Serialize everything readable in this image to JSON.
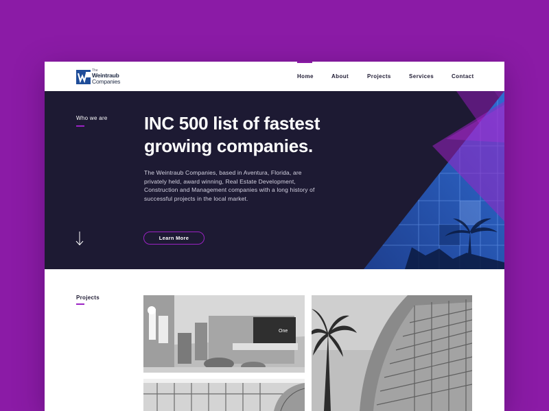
{
  "brand": {
    "logo_the": "The",
    "logo_line1": "Weintraub",
    "logo_line2": "Companies",
    "accent_color": "#8b1ba6",
    "dark_color": "#1d1a33",
    "blue_color": "#1f4d99"
  },
  "nav": {
    "items": [
      {
        "label": "Home",
        "active": true
      },
      {
        "label": "About",
        "active": false
      },
      {
        "label": "Projects",
        "active": false
      },
      {
        "label": "Services",
        "active": false
      },
      {
        "label": "Contact",
        "active": false
      }
    ]
  },
  "hero": {
    "section_label": "Who we are",
    "title_line1": "INC 500 list of fastest",
    "title_line2": "growing companies.",
    "body": "The Weintraub Companies, based in Aventura, Florida, are privately held, award winning, Real Estate Development, Construction and Management companies with a long history of successful projects in the local market.",
    "button_label": "Learn More",
    "scroll_icon": "arrow-down-icon"
  },
  "projects": {
    "section_label": "Projects",
    "tiles": [
      {
        "name": "lobby-interior",
        "sign_text": "One"
      },
      {
        "name": "curved-tower"
      },
      {
        "name": "glass-atrium"
      }
    ]
  }
}
